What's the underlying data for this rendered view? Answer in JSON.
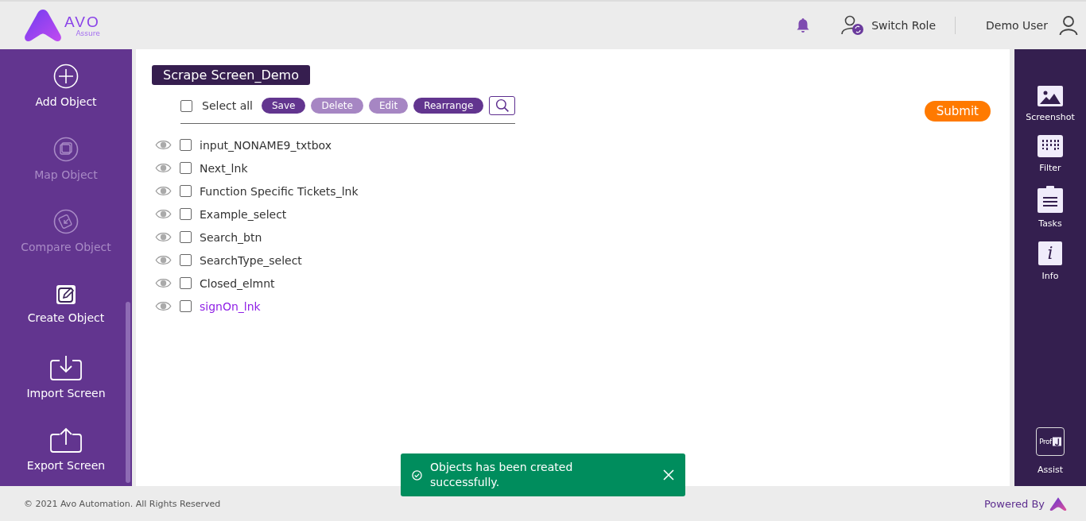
{
  "header": {
    "logo": {
      "name": "AVO",
      "tagline": "Assure"
    },
    "switch_role": "Switch Role",
    "user_name": "Demo User"
  },
  "sidebar": {
    "items": [
      {
        "label": "Add Object",
        "disabled": false
      },
      {
        "label": "Map Object",
        "disabled": true
      },
      {
        "label": "Compare Object",
        "disabled": true
      },
      {
        "label": "Create Object",
        "disabled": false
      },
      {
        "label": "Import Screen",
        "disabled": false
      },
      {
        "label": "Export Screen",
        "disabled": false
      }
    ]
  },
  "screen_title": "Scrape Screen_Demo",
  "toolbar": {
    "select_all": {
      "label": "Select all",
      "checked": false
    },
    "buttons": [
      {
        "label": "Save",
        "disabled": false
      },
      {
        "label": "Delete",
        "disabled": true
      },
      {
        "label": "Edit",
        "disabled": true
      },
      {
        "label": "Rearrange",
        "disabled": false
      }
    ],
    "submit": "Submit"
  },
  "objects": [
    {
      "name": "input_NONAME9_txtbox",
      "checked": false,
      "highlighted": false
    },
    {
      "name": "Next_lnk",
      "checked": false,
      "highlighted": false
    },
    {
      "name": "Function Specific Tickets_lnk",
      "checked": false,
      "highlighted": false
    },
    {
      "name": "Example_select",
      "checked": false,
      "highlighted": false
    },
    {
      "name": "Search_btn",
      "checked": false,
      "highlighted": false
    },
    {
      "name": "SearchType_select",
      "checked": false,
      "highlighted": false
    },
    {
      "name": "Closed_elmnt",
      "checked": false,
      "highlighted": false
    },
    {
      "name": "signOn_lnk",
      "checked": false,
      "highlighted": true
    }
  ],
  "right_panel": {
    "items": [
      {
        "label": "Screenshot"
      },
      {
        "label": "Filter"
      },
      {
        "label": "Tasks"
      },
      {
        "label": "Info",
        "glyph": "i"
      }
    ],
    "assist": {
      "label": "Assist",
      "badge": "Prof"
    }
  },
  "toast": {
    "message": "Objects has been created successfully."
  },
  "footer": {
    "copyright": "© 2021 Avo Automation. All Rights Reserved",
    "powered_by": "Powered By"
  }
}
